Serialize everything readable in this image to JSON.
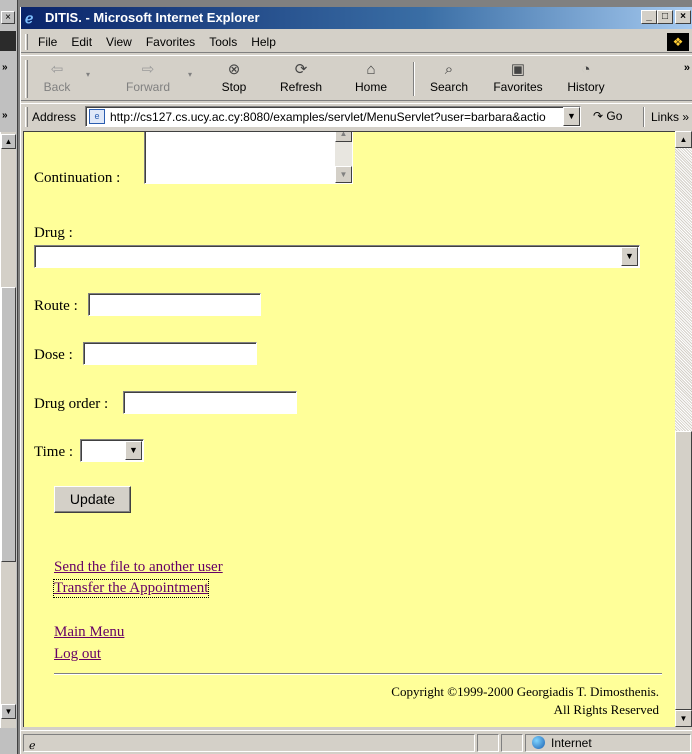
{
  "window": {
    "title": "DITIS. - Microsoft Internet Explorer",
    "btn_min": "_",
    "btn_max": "□",
    "btn_close": "×"
  },
  "menu": [
    "File",
    "Edit",
    "View",
    "Favorites",
    "Tools",
    "Help"
  ],
  "toolbar": {
    "back": "Back",
    "forward": "Forward",
    "stop": "Stop",
    "refresh": "Refresh",
    "home": "Home",
    "search": "Search",
    "favorites": "Favorites",
    "history": "History",
    "more": "»"
  },
  "address": {
    "label": "Address",
    "url": "http://cs127.cs.ucy.ac.cy:8080/examples/servlet/MenuServlet?user=barbara&actio",
    "go": "Go",
    "links": "Links"
  },
  "form": {
    "continuation_label": "Continuation :",
    "drug_label": "Drug :",
    "drug_value": "",
    "route_label": "Route :",
    "route_value": "",
    "dose_label": "Dose :",
    "dose_value": "",
    "drug_order_label": "Drug order :",
    "drug_order_value": "",
    "time_label": "Time :",
    "time_value": "",
    "update_button": "Update"
  },
  "links": {
    "send_file": "Send the file to another user",
    "transfer": "Transfer the Appointment",
    "main_menu": "Main Menu",
    "logout": "Log out"
  },
  "footer": {
    "copyright_line1": "Copyright ©1999-2000 Georgiadis T. Dimosthenis.",
    "copyright_line2": "All Rights Reserved"
  },
  "status": {
    "zone": "Internet"
  },
  "colors": {
    "page_bg": "#ffff99",
    "visited_link": "#660066",
    "titlebar": "#0a246a"
  }
}
